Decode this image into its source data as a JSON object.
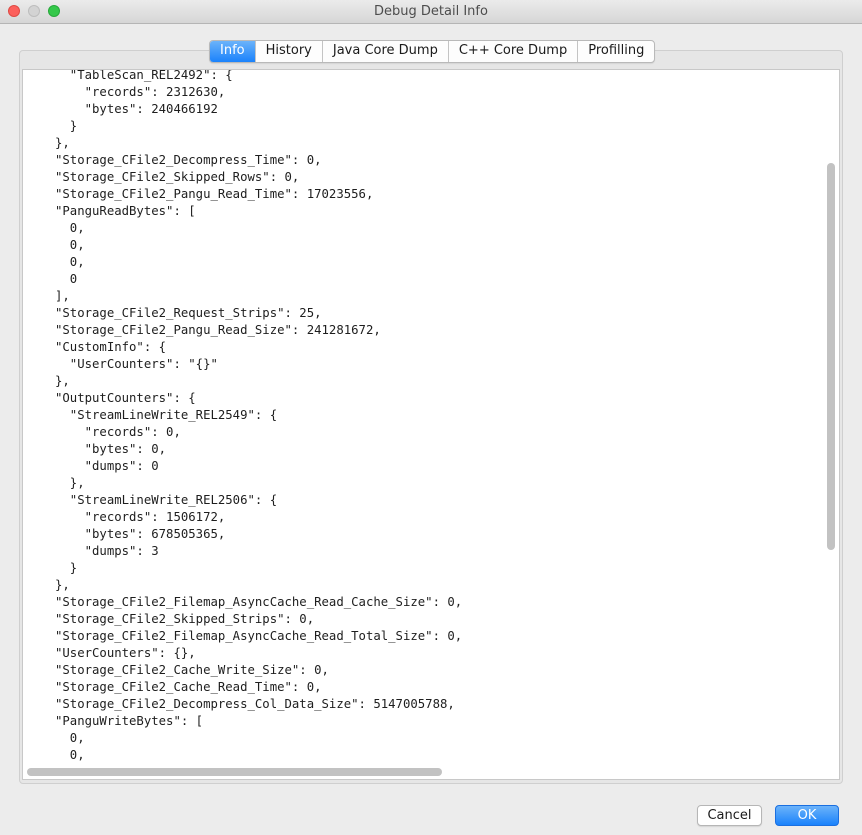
{
  "window": {
    "title": "Debug Detail Info"
  },
  "tabs": [
    {
      "label": "Info",
      "active": true
    },
    {
      "label": "History",
      "active": false
    },
    {
      "label": "Java Core Dump",
      "active": false
    },
    {
      "label": "C++ Core Dump",
      "active": false
    },
    {
      "label": "Profilling",
      "active": false
    }
  ],
  "content": {
    "json_text": "  \"TableScan_REL2492\": {\n    \"records\": 2312630,\n    \"bytes\": 240466192\n  }\n},\n\"Storage_CFile2_Decompress_Time\": 0,\n\"Storage_CFile2_Skipped_Rows\": 0,\n\"Storage_CFile2_Pangu_Read_Time\": 17023556,\n\"PanguReadBytes\": [\n  0,\n  0,\n  0,\n  0\n],\n\"Storage_CFile2_Request_Strips\": 25,\n\"Storage_CFile2_Pangu_Read_Size\": 241281672,\n\"CustomInfo\": {\n  \"UserCounters\": \"{}\"\n},\n\"OutputCounters\": {\n  \"StreamLineWrite_REL2549\": {\n    \"records\": 0,\n    \"bytes\": 0,\n    \"dumps\": 0\n  },\n  \"StreamLineWrite_REL2506\": {\n    \"records\": 1506172,\n    \"bytes\": 678505365,\n    \"dumps\": 3\n  }\n},\n\"Storage_CFile2_Filemap_AsyncCache_Read_Cache_Size\": 0,\n\"Storage_CFile2_Skipped_Strips\": 0,\n\"Storage_CFile2_Filemap_AsyncCache_Read_Total_Size\": 0,\n\"UserCounters\": {},\n\"Storage_CFile2_Cache_Write_Size\": 0,\n\"Storage_CFile2_Cache_Read_Time\": 0,\n\"Storage_CFile2_Decompress_Col_Data_Size\": 5147005788,\n\"PanguWriteBytes\": [\n  0,\n  0,"
  },
  "buttons": {
    "cancel_label": "Cancel",
    "ok_label": "OK"
  },
  "colors": {
    "accent": "#1a82fb",
    "close": "#fc605c",
    "maximize": "#34c84a"
  }
}
